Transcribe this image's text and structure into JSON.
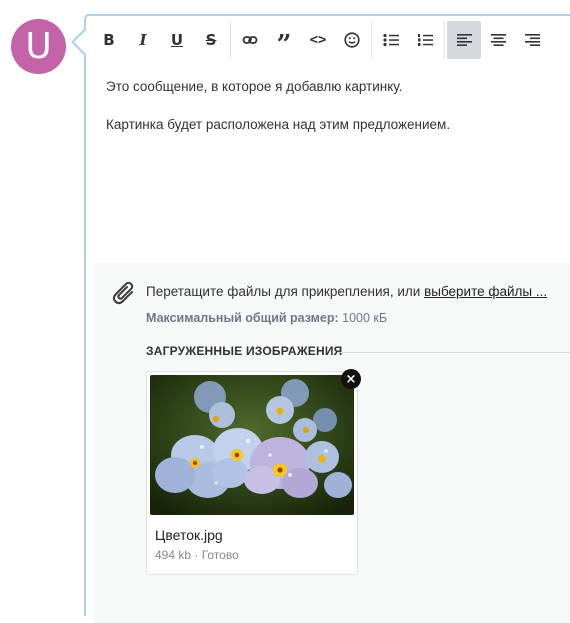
{
  "avatar": {
    "letter": "U",
    "color": "#c563a8"
  },
  "toolbar": {
    "bold": "B",
    "italic": "I",
    "underline": "U",
    "strikethrough": "S",
    "quote": "”",
    "code": "<>",
    "icons": [
      "link-icon",
      "quote-icon",
      "code-icon",
      "smiley-icon",
      "bullet-list-icon",
      "numbered-list-icon",
      "align-left-icon",
      "align-center-icon",
      "align-right-icon"
    ],
    "active": "align-left"
  },
  "message": {
    "line1": "Это сообщение, в которое я добавлю картинку.",
    "line2": "Картинка будет расположена над этим предложением."
  },
  "attachments": {
    "drop_text": "Перетащите файлы для прикрепления, или ",
    "choose_link": "выберите файлы ...",
    "max_size_label": "Максимальный общий размер:",
    "max_size_value": " 1000 кБ",
    "uploaded_title": "ЗАГРУЖЕННЫЕ ИЗОБРАЖЕНИЯ",
    "files": [
      {
        "name": "Цветок.jpg",
        "meta": "494 kb · Готово",
        "remove": "×"
      }
    ]
  },
  "colors": {
    "accent_border": "#a9d1f0",
    "active_tool": "#d5d8dc",
    "panel_bg": "#f7f8f8"
  }
}
